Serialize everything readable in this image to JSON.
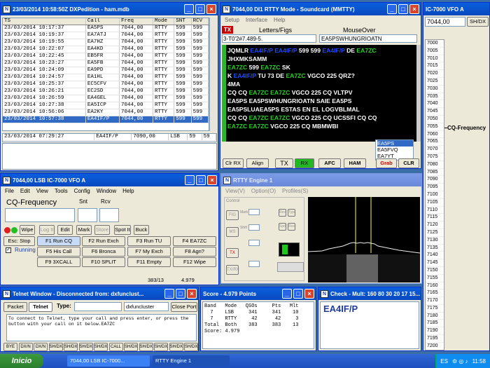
{
  "logwin": {
    "title": "23/03/2014 10:58:50Z DXPedition - ham.mdb",
    "cols": [
      "TS",
      "Call",
      "Freq",
      "Mode",
      "SNT",
      "RCV"
    ],
    "rows": [
      [
        "23/03/2014 10:17:37",
        "EA5PS",
        "7044,00",
        "RTTY",
        "599",
        "599"
      ],
      [
        "23/03/2014 10:19:37",
        "EA7ATJ",
        "7044,00",
        "RTTY",
        "599",
        "599"
      ],
      [
        "23/03/2014 10:19:55",
        "EA7HZ",
        "7044,00",
        "RTTY",
        "599",
        "599"
      ],
      [
        "23/03/2014 10:22:07",
        "EA4KD",
        "7044,00",
        "RTTY",
        "599",
        "599"
      ],
      [
        "23/03/2014 10:22:45",
        "EB5FR",
        "7044,00",
        "RTTY",
        "599",
        "599"
      ],
      [
        "23/03/2014 10:23:27",
        "EA5FB",
        "7044,00",
        "RTTY",
        "599",
        "599"
      ],
      [
        "23/03/2014 10:24:09",
        "EA9PD",
        "7044,00",
        "RTTY",
        "599",
        "599"
      ],
      [
        "23/03/2014 10:24:57",
        "EA1HL",
        "7044,00",
        "RTTY",
        "599",
        "599"
      ],
      [
        "23/03/2014 10:25:37",
        "EC5CFV",
        "7044,00",
        "RTTY",
        "599",
        "599"
      ],
      [
        "23/03/2014 10:26:21",
        "EC2SD",
        "7044,00",
        "RTTY",
        "599",
        "599"
      ],
      [
        "23/03/2014 10:26:59",
        "EA4GEL",
        "7044,00",
        "RTTY",
        "599",
        "599"
      ],
      [
        "23/03/2014 10:27:38",
        "EA5ICP",
        "7044,00",
        "RTTY",
        "599",
        "599"
      ],
      [
        "23/03/2014 10:56:06",
        "EA2KY",
        "7044,00",
        "RTTY",
        "599",
        "599"
      ],
      [
        "23/03/2014 10:57:38",
        "EA4IF/P",
        "7044,00",
        "RTTY",
        "599",
        "599"
      ]
    ],
    "entry": [
      "23/03/2014 07:29:27",
      "EA4IF/P",
      "7090,00",
      "LSB",
      "59",
      "59"
    ]
  },
  "mmtty": {
    "title": "7044,00 DI1 RTTY Mode - Soundcard (MMTTY)",
    "menu": [
      "Setup",
      "Interface",
      "Help"
    ],
    "tx": "TX",
    "letters": "Letters/Figs",
    "mouseover": "MouseOver",
    "rxline": "3-T0'2#7.489-5.",
    "mouseval": "EA5PSWHUNGRIOATN",
    "lines": [
      "JQMLR EA4IF/P EA4IF/P 599 599 EA4IF/P DE EA7ZC",
      "JHXMKSAMM",
      "EA7ZC 599 EA7ZC SK",
      "K EA4IF/P TU 73  DE EA7ZC VGCO 225 QRZ?",
      "4MA",
      " CQ CQ EA7ZC EA7ZC VGCO 225 CQ VLTPV",
      " EA5PS EA5PSWHUNGRIOATN SAIE EA5PS",
      "EA5PSLUAEA5PS ESTAS EN EL LOGVBLMAL",
      "CQ CQ EA7ZC EA7ZC VGCO 225 CQ UCSSFI CQ CQ",
      "EA7ZC EA7ZC VGCO 225 CQ MBMWBI"
    ],
    "calls": [
      "EA5PS",
      "EA5FVQ",
      "EA7YT"
    ],
    "buttons": [
      "Clr RX",
      "Align",
      "TX",
      "RX",
      "AFC",
      "HAM",
      "Grab",
      "CLR"
    ]
  },
  "rig": {
    "title": "IC-7000 VFO A",
    "freq": "7044,00",
    "shdx": "SH/DX",
    "scale": [
      "7000",
      "7005",
      "7010",
      "7015",
      "7020",
      "7025",
      "7030",
      "7035",
      "7040",
      "7045",
      "7050",
      "7055",
      "7060",
      "7065",
      "7070",
      "7075",
      "7080",
      "7085",
      "7090",
      "7095",
      "7100",
      "7105",
      "7110",
      "7115",
      "7120",
      "7125",
      "7130",
      "7135",
      "7140",
      "7145",
      "7150",
      "7155",
      "7160",
      "7165",
      "7170",
      "7175",
      "7180",
      "7185",
      "7190",
      "7195",
      "7200"
    ],
    "spot": "CQ-Frequency"
  },
  "entry": {
    "title": "7044,00 LSB IC-7000 VFO A",
    "menu": [
      "File",
      "Edit",
      "View",
      "Tools",
      "Config",
      "Window",
      "Help"
    ],
    "call_label": "CQ-Frequency",
    "snt_label": "Snt",
    "rcv_label": "Rcv",
    "buttons": [
      "Wipe",
      "Log It",
      "Edit",
      "Mark",
      "Store",
      "Spot It",
      "Buck"
    ],
    "fkeys": [
      "Esc: Stop",
      "F1 Run CQ",
      "F2 Run Exch",
      "F3 Run TU",
      "F4 EA7ZC",
      "F5 His Call",
      "F6 Bronca",
      "F7 My Exch",
      "F8 Agn?",
      "F9 3XCALL",
      "F10 SPLIT",
      "F11 Empty",
      "F12 Wipe"
    ],
    "running": "Running",
    "status1": "383/13",
    "status2": "4.979"
  },
  "engine": {
    "title": "RTTY Engine 1",
    "menu": [
      "View(V)",
      "Option(O)",
      "Profiles(S)"
    ],
    "left_labels": [
      "Control",
      "FIG",
      "MS",
      "TX",
      "TX/RX"
    ],
    "btns": [
      "Mark",
      "Shift",
      "Rev",
      "Spd",
      "Type",
      "Reso"
    ]
  },
  "telnet": {
    "title": "Telnet Window - Disconnected from: dxfunclust...",
    "tabs": [
      "Packet",
      "Telnet"
    ],
    "type_label": "Type:",
    "cluster": "dxfuncluster",
    "close": "Close Port",
    "msg": "To connect to Telnet, type your call and press enter, or press the button with your call on it below.EA7ZC",
    "keys": [
      "BYE",
      "DX/N",
      "DX/N",
      "SH/DX",
      "SH/DX",
      "SH/DX",
      "SH/DX",
      "CALL",
      "SH/DX",
      "SH/DX",
      "SH/DX",
      "SH/DX",
      "SH/DX"
    ]
  },
  "score": {
    "title": "Score - 4.979 Points",
    "header": "Band   Mode   QSOs     Pts   Mlt",
    "rows": [
      "  7    LSB     341     341    10",
      "  7    RTTY     42      42     3",
      "Total  Both    383     383    13",
      "Score: 4.979"
    ]
  },
  "check": {
    "title": "Check - Mult: 160 80 30 20 17 15...",
    "call": "EA4IF/P"
  },
  "taskbar": {
    "start": "Inicio",
    "tasks": [
      "7044,00 LSB IC-7000...",
      "RTTY Engine 1"
    ],
    "lang": "ES",
    "time": "11:58"
  }
}
